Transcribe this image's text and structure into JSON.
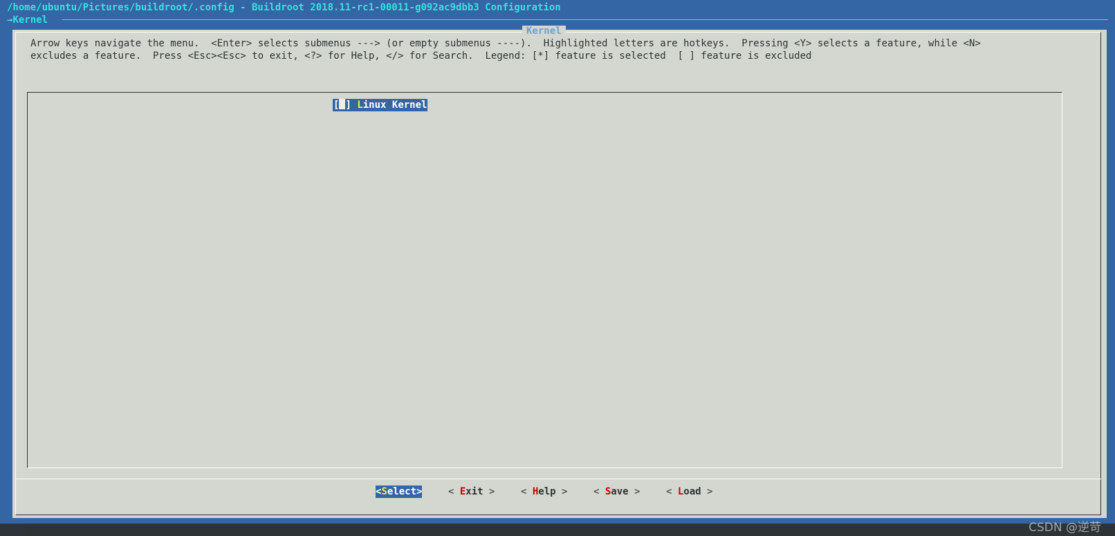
{
  "window": {
    "title": "/home/ubuntu/Pictures/buildroot/.config - Buildroot 2018.11-rc1-00011-g092ac9dbb3 Configuration",
    "breadcrumb_arrow": "→",
    "breadcrumb": "Kernel"
  },
  "dialog": {
    "title": "Kernel",
    "help_line_1": "Arrow keys navigate the menu.  <Enter> selects submenus ---> (or empty submenus ----).  Highlighted letters are hotkeys.  Pressing <Y> selects a feature, while <N>",
    "help_line_2": "excludes a feature.  Press <Esc><Esc> to exit, <?> for Help, </> for Search.  Legend: [*] feature is selected  [ ] feature is excluded"
  },
  "menu": {
    "items": [
      {
        "checkbox_open": "[",
        "checkbox_close": "]",
        "hotkey": "L",
        "rest": "inux Kernel",
        "checked": false,
        "selected": true
      }
    ]
  },
  "buttons": {
    "select": {
      "open": "<",
      "hotkey": "S",
      "rest": "elect",
      "close": ">"
    },
    "exit": {
      "open": "< ",
      "hotkey": "E",
      "rest": "xit",
      "close": " >"
    },
    "help": {
      "open": "< ",
      "hotkey": "H",
      "rest": "elp",
      "close": " >"
    },
    "save": {
      "open": "< ",
      "hotkey": "S",
      "rest": "ave",
      "close": " >"
    },
    "load": {
      "open": "< ",
      "hotkey": "L",
      "rest": "oad",
      "close": " >"
    }
  },
  "watermark": "CSDN @逆苛",
  "colors": {
    "background": "#3465a4",
    "dialog": "#d3d7cf",
    "title_text": "#34e2e2",
    "highlight": "#3465a4",
    "hotkey_selected": "#fce94f",
    "hotkey": "#cc0000"
  }
}
